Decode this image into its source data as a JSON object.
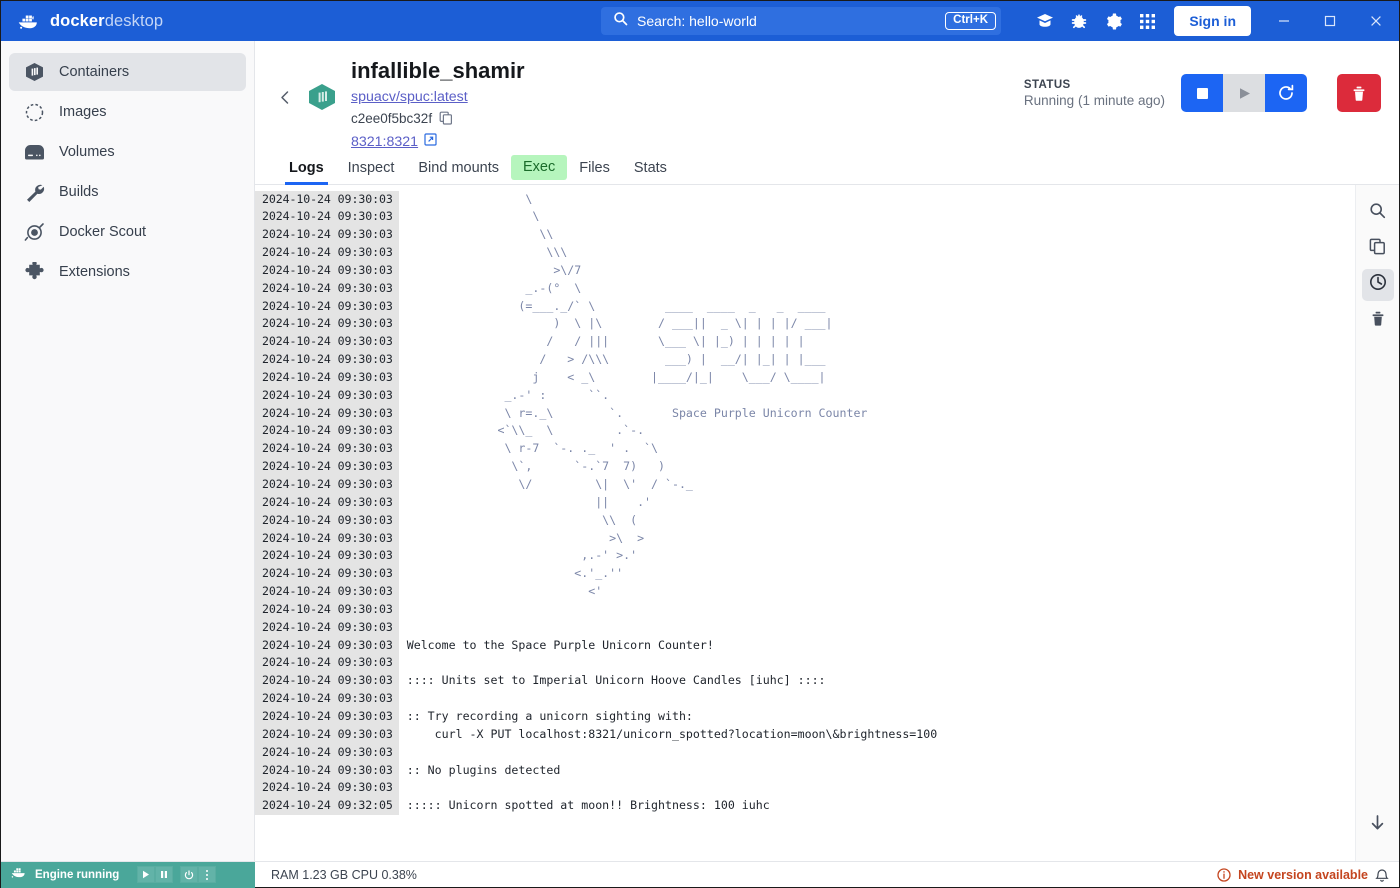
{
  "titlebar": {
    "brand_bold": "docker",
    "brand_light": "desktop",
    "search_label": "Search: hello-world",
    "search_placeholder": "Search",
    "shortcut": "Ctrl+K",
    "signin_label": "Sign in",
    "icons": [
      "learning-center-icon",
      "bug-icon",
      "settings-gear-icon",
      "apps-grid-icon"
    ],
    "window_controls": [
      "minimize-icon",
      "maximize-icon",
      "close-icon"
    ],
    "accent_color": "#1c5ed6"
  },
  "sidebar": {
    "items": [
      {
        "label": "Containers",
        "icon": "container-icon",
        "active": true
      },
      {
        "label": "Images",
        "icon": "images-icon",
        "active": false
      },
      {
        "label": "Volumes",
        "icon": "volumes-icon",
        "active": false
      },
      {
        "label": "Builds",
        "icon": "wrench-icon",
        "active": false
      },
      {
        "label": "Docker Scout",
        "icon": "scout-icon",
        "active": false
      },
      {
        "label": "Extensions",
        "icon": "puzzle-icon",
        "active": false
      }
    ]
  },
  "container": {
    "name": "infallible_shamir",
    "image": "spuacv/spuc:latest",
    "id": "c2ee0f5bc32f",
    "port": "8321:8321",
    "status_caption": "STATUS",
    "status_value": "Running (1 minute ago)",
    "actions": [
      "stop-button",
      "start-button",
      "restart-button",
      "delete-button"
    ],
    "cube_color": "#3aa08c"
  },
  "tabs": [
    {
      "label": "Logs",
      "state": "active"
    },
    {
      "label": "Inspect",
      "state": "normal"
    },
    {
      "label": "Bind mounts",
      "state": "normal"
    },
    {
      "label": "Exec",
      "state": "highlighted"
    },
    {
      "label": "Files",
      "state": "normal"
    },
    {
      "label": "Stats",
      "state": "normal"
    }
  ],
  "log_rail": {
    "buttons": [
      {
        "icon": "search-icon",
        "active": false
      },
      {
        "icon": "copy-icon",
        "active": false
      },
      {
        "icon": "clock-icon",
        "active": true
      },
      {
        "icon": "trash-icon",
        "active": false
      }
    ],
    "scroll_to_bottom": "arrow-down-icon"
  },
  "logs": [
    {
      "ts": "2024-10-24 09:30:03",
      "msg": "                 \\",
      "art": true
    },
    {
      "ts": "2024-10-24 09:30:03",
      "msg": "                  \\",
      "art": true
    },
    {
      "ts": "2024-10-24 09:30:03",
      "msg": "                   \\\\",
      "art": true
    },
    {
      "ts": "2024-10-24 09:30:03",
      "msg": "                    \\\\\\",
      "art": true
    },
    {
      "ts": "2024-10-24 09:30:03",
      "msg": "                     >\\/7",
      "art": true
    },
    {
      "ts": "2024-10-24 09:30:03",
      "msg": "                 _.-(°  \\",
      "art": true
    },
    {
      "ts": "2024-10-24 09:30:03",
      "msg": "                (=___._/` \\          ____  ____  _   _  ____",
      "art": true
    },
    {
      "ts": "2024-10-24 09:30:03",
      "msg": "                     )  \\ |\\        / ___||  _ \\| | | |/ ___|",
      "art": true
    },
    {
      "ts": "2024-10-24 09:30:03",
      "msg": "                    /   / |||       \\___ \\| |_) | | | | |",
      "art": true
    },
    {
      "ts": "2024-10-24 09:30:03",
      "msg": "                   /   > /\\\\\\        ___) |  __/| |_| | |___",
      "art": true
    },
    {
      "ts": "2024-10-24 09:30:03",
      "msg": "                  j    < _\\        |____/|_|    \\___/ \\____|",
      "art": true
    },
    {
      "ts": "2024-10-24 09:30:03",
      "msg": "              _.-' :      ``.",
      "art": true
    },
    {
      "ts": "2024-10-24 09:30:03",
      "msg": "              \\ r=._\\        `.       Space Purple Unicorn Counter",
      "art": true
    },
    {
      "ts": "2024-10-24 09:30:03",
      "msg": "             <`\\\\_  \\         .`-.",
      "art": true
    },
    {
      "ts": "2024-10-24 09:30:03",
      "msg": "              \\ r-7  `-. ._  ' .  `\\",
      "art": true
    },
    {
      "ts": "2024-10-24 09:30:03",
      "msg": "               \\`,      `-.`7  7)   )",
      "art": true
    },
    {
      "ts": "2024-10-24 09:30:03",
      "msg": "                \\/         \\|  \\'  / `-._",
      "art": true
    },
    {
      "ts": "2024-10-24 09:30:03",
      "msg": "                           ||    .'",
      "art": true
    },
    {
      "ts": "2024-10-24 09:30:03",
      "msg": "                            \\\\  (",
      "art": true
    },
    {
      "ts": "2024-10-24 09:30:03",
      "msg": "                             >\\  >",
      "art": true
    },
    {
      "ts": "2024-10-24 09:30:03",
      "msg": "                         ,.-' >.'",
      "art": true
    },
    {
      "ts": "2024-10-24 09:30:03",
      "msg": "                        <.'_.''",
      "art": true
    },
    {
      "ts": "2024-10-24 09:30:03",
      "msg": "                          <'",
      "art": true
    },
    {
      "ts": "2024-10-24 09:30:03",
      "msg": "",
      "art": true
    },
    {
      "ts": "2024-10-24 09:30:03",
      "msg": "",
      "art": false
    },
    {
      "ts": "2024-10-24 09:30:03",
      "msg": "Welcome to the Space Purple Unicorn Counter!",
      "art": false
    },
    {
      "ts": "2024-10-24 09:30:03",
      "msg": "",
      "art": false
    },
    {
      "ts": "2024-10-24 09:30:03",
      "msg": ":::: Units set to Imperial Unicorn Hoove Candles [iuhc] ::::",
      "art": false
    },
    {
      "ts": "2024-10-24 09:30:03",
      "msg": "",
      "art": false
    },
    {
      "ts": "2024-10-24 09:30:03",
      "msg": ":: Try recording a unicorn sighting with:",
      "art": false
    },
    {
      "ts": "2024-10-24 09:30:03",
      "msg": "    curl -X PUT localhost:8321/unicorn_spotted?location=moon\\&brightness=100",
      "art": false
    },
    {
      "ts": "2024-10-24 09:30:03",
      "msg": "",
      "art": false
    },
    {
      "ts": "2024-10-24 09:30:03",
      "msg": ":: No plugins detected",
      "art": false
    },
    {
      "ts": "2024-10-24 09:30:03",
      "msg": "",
      "art": false
    },
    {
      "ts": "2024-10-24 09:32:05",
      "msg": "::::: Unicorn spotted at moon!! Brightness: 100 iuhc",
      "art": false
    }
  ],
  "statusbar": {
    "engine_label": "Engine running",
    "engine_buttons": [
      "play-icon",
      "pause-icon",
      "power-icon",
      "kebab-menu-icon"
    ],
    "metrics": "RAM 1.23 GB  CPU 0.38%",
    "notice": "New version available",
    "notice_color": "#c4451f",
    "bell": "bell-icon",
    "engine_color": "#4aa79a"
  }
}
